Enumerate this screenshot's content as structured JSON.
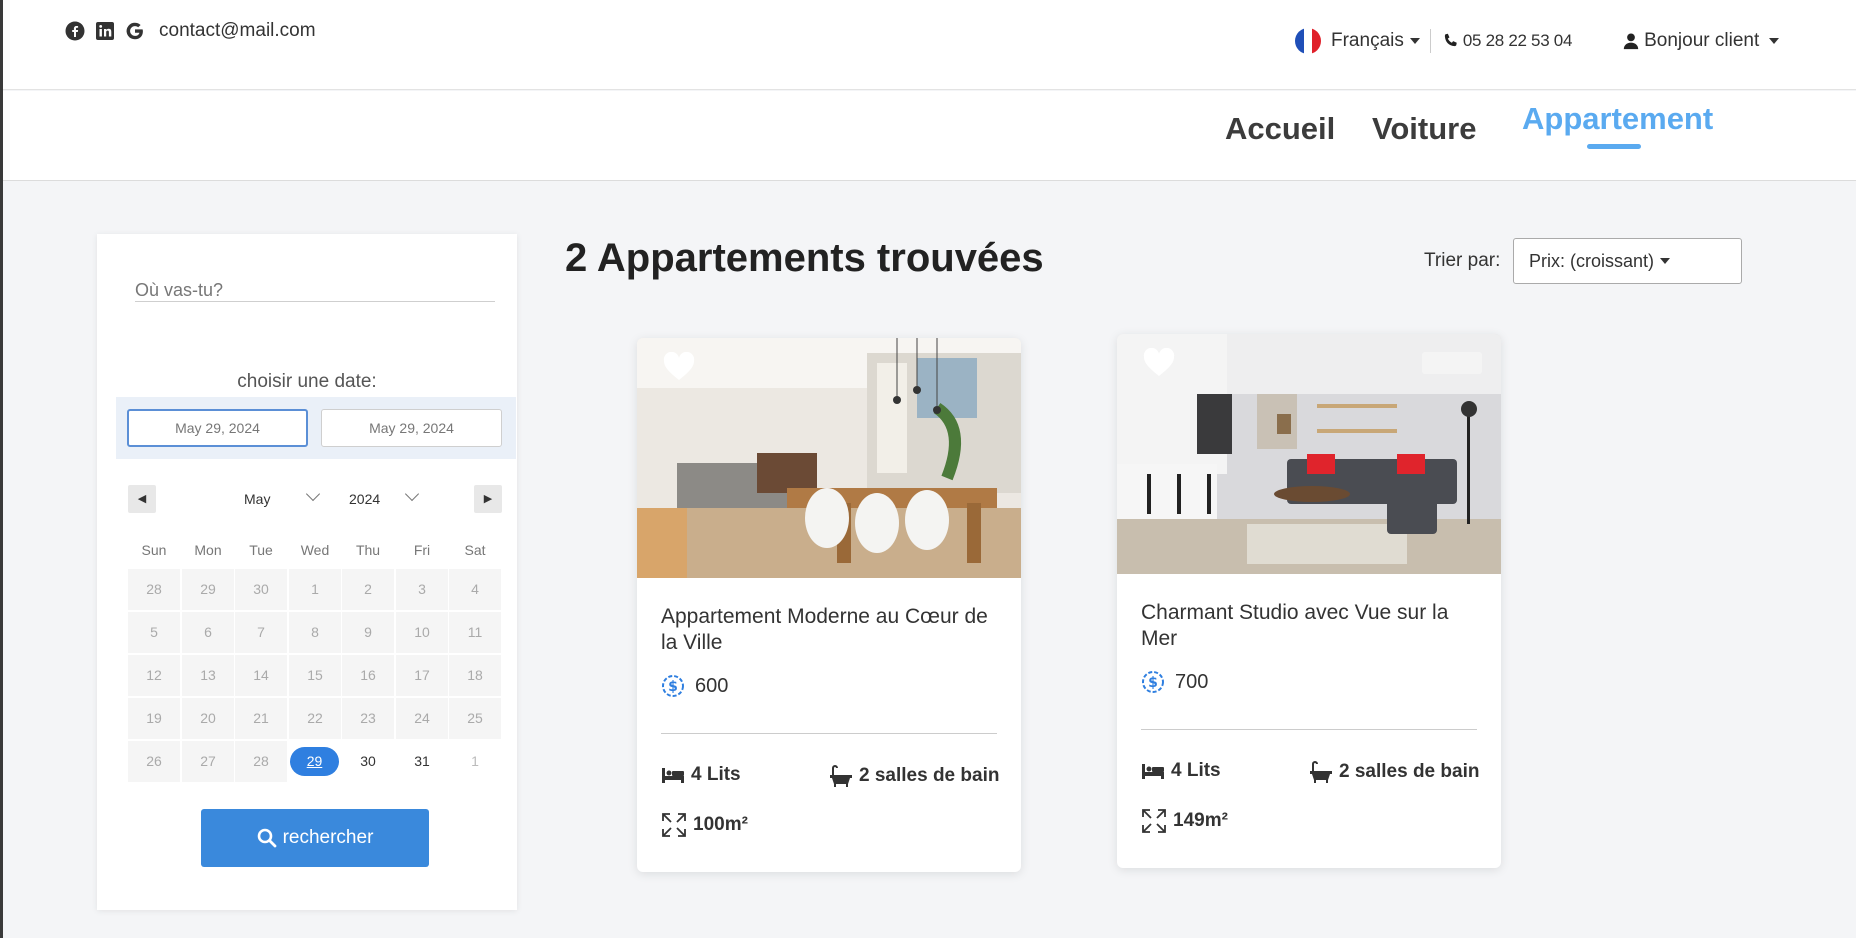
{
  "header": {
    "contact_email": "contact@mail.com",
    "language": "Français",
    "phone": "05 28 22 53 04",
    "user_greeting": "Bonjour client"
  },
  "nav": {
    "items": [
      {
        "label": "Accueil"
      },
      {
        "label": "Voiture"
      },
      {
        "label": "Appartement",
        "active": true
      }
    ]
  },
  "search": {
    "destination_placeholder": "Où vas-tu?",
    "date_label": "choisir une date:",
    "start_date": "May 29, 2024",
    "end_date": "May 29, 2024",
    "calendar": {
      "month": "May",
      "year": "2024",
      "weekdays": [
        "Sun",
        "Mon",
        "Tue",
        "Wed",
        "Thu",
        "Fri",
        "Sat"
      ],
      "weeks": [
        [
          "28",
          "29",
          "30",
          "1",
          "2",
          "3",
          "4"
        ],
        [
          "5",
          "6",
          "7",
          "8",
          "9",
          "10",
          "11"
        ],
        [
          "12",
          "13",
          "14",
          "15",
          "16",
          "17",
          "18"
        ],
        [
          "19",
          "20",
          "21",
          "22",
          "23",
          "24",
          "25"
        ],
        [
          "26",
          "27",
          "28",
          "29",
          "30",
          "31",
          "1"
        ]
      ],
      "selected_day": "29"
    },
    "button_label": "rechercher"
  },
  "results": {
    "title": "2 Appartements trouvées",
    "sort_label": "Trier par:",
    "sort_value": "Prix: (croissant)",
    "listings": [
      {
        "title": "Appartement Moderne au Cœur de la Ville",
        "price": "600",
        "beds": "4 Lits",
        "baths": "2 salles de bain",
        "area": "100m²"
      },
      {
        "title": "Charmant Studio avec Vue sur la Mer",
        "price": "700",
        "beds": "4 Lits",
        "baths": "2 salles de bain",
        "area": "149m²"
      }
    ]
  },
  "colors": {
    "accent": "#5aaaf0",
    "button": "#3a89dc",
    "selected_day": "#2f7fe0"
  }
}
